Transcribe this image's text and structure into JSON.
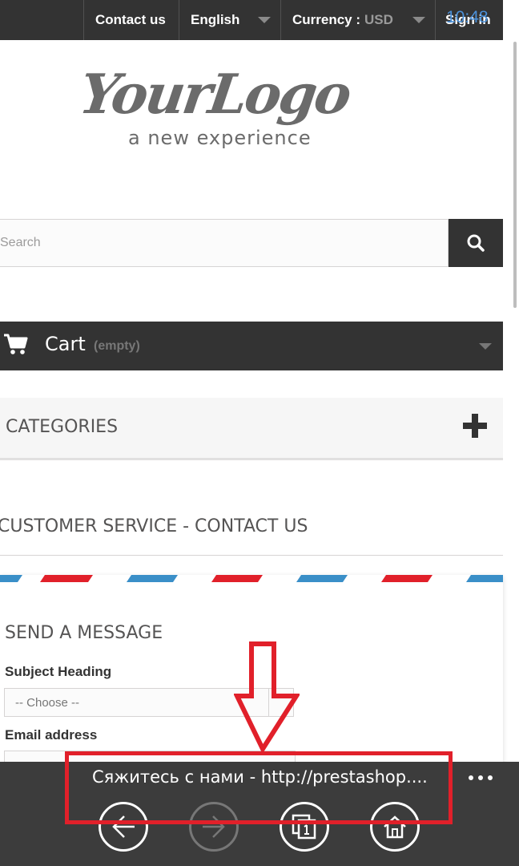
{
  "status_bar": {
    "time": "10:48"
  },
  "topnav": {
    "contact_label": "Contact us",
    "language_label": "English",
    "currency_label": "Currency :",
    "currency_value": "USD",
    "signin_label": "Sign in"
  },
  "logo": {
    "main_text": "YourLogo",
    "tagline": "a new experience"
  },
  "search": {
    "placeholder": "Search"
  },
  "cart": {
    "title": "Cart",
    "status": "(empty)"
  },
  "categories": {
    "title": "CATEGORIES"
  },
  "page": {
    "heading": "CUSTOMER SERVICE - CONTACT US",
    "form_title": "SEND A MESSAGE",
    "subject_label": "Subject Heading",
    "subject_value": "-- Choose --",
    "email_label": "Email address"
  },
  "appbar": {
    "address": "Сяжитесь с нами - http://prestashop...."
  },
  "colors": {
    "dark": "#333333",
    "annotation_red": "#e1202a",
    "envelope_red": "#e1202a",
    "envelope_blue": "#3a8fc8",
    "clock_blue": "#4a90d9"
  },
  "icons": {
    "search": "search-icon",
    "cart": "cart-icon",
    "plus": "plus-icon",
    "back": "back-arrow-icon",
    "forward": "forward-arrow-icon",
    "tabs": "tabs-icon",
    "home": "home-icon",
    "more": "more-dots-icon"
  }
}
